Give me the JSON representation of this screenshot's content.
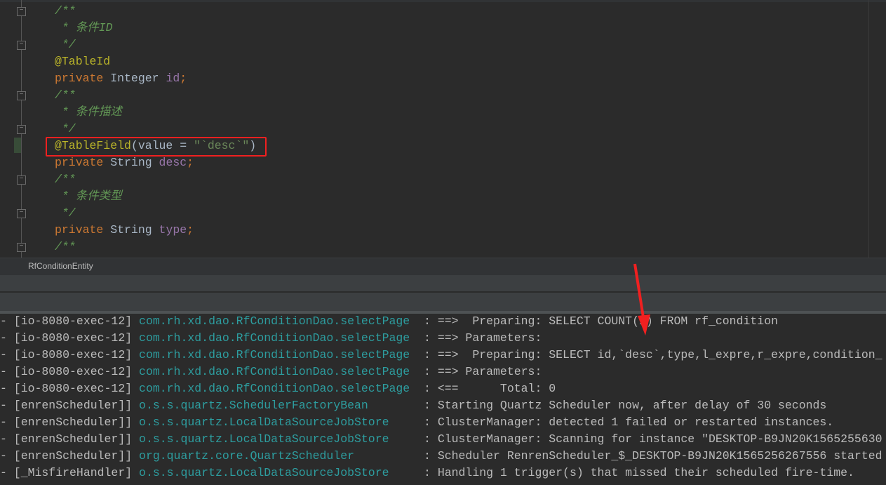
{
  "editor": {
    "lines": [
      {
        "kind": "comment",
        "text": "/**"
      },
      {
        "kind": "comment",
        "text": " * 条件ID"
      },
      {
        "kind": "comment",
        "text": " */"
      },
      {
        "kind": "annotation",
        "text": "@TableId"
      },
      {
        "kind": "field",
        "keyword": "private",
        "type": "Integer",
        "name": "id",
        "end": ";"
      },
      {
        "kind": "comment",
        "text": "/**"
      },
      {
        "kind": "comment",
        "text": " * 条件描述"
      },
      {
        "kind": "comment",
        "text": " */"
      },
      {
        "kind": "annotation-call",
        "annotation": "@TableField",
        "open": "(value = ",
        "string": "\"`desc`\"",
        "close": ")"
      },
      {
        "kind": "field",
        "keyword": "private",
        "type": "String",
        "name": "desc",
        "end": ";"
      },
      {
        "kind": "comment",
        "text": "/**"
      },
      {
        "kind": "comment",
        "text": " * 条件类型"
      },
      {
        "kind": "comment",
        "text": " */"
      },
      {
        "kind": "field",
        "keyword": "private",
        "type": "String",
        "name": "type",
        "end": ";"
      },
      {
        "kind": "comment",
        "text": "/**"
      }
    ],
    "breadcrumb": "RfConditionEntity"
  },
  "console": {
    "lines": [
      {
        "thread": "- [io-8080-exec-12] ",
        "logger": "com.rh.xd.dao.RfConditionDao.selectPage  ",
        "message": ": ==>  Preparing: SELECT COUNT(1) FROM rf_condition"
      },
      {
        "thread": "- [io-8080-exec-12] ",
        "logger": "com.rh.xd.dao.RfConditionDao.selectPage  ",
        "message": ": ==> Parameters: "
      },
      {
        "thread": "- [io-8080-exec-12] ",
        "logger": "com.rh.xd.dao.RfConditionDao.selectPage  ",
        "message": ": ==>  Preparing: SELECT id,`desc`,type,l_expre,r_expre,condition_"
      },
      {
        "thread": "- [io-8080-exec-12] ",
        "logger": "com.rh.xd.dao.RfConditionDao.selectPage  ",
        "message": ": ==> Parameters: "
      },
      {
        "thread": "- [io-8080-exec-12] ",
        "logger": "com.rh.xd.dao.RfConditionDao.selectPage  ",
        "message": ": <==      Total: 0"
      },
      {
        "thread": "- [enrenScheduler]] ",
        "logger": "o.s.s.quartz.SchedulerFactoryBean        ",
        "message": ": Starting Quartz Scheduler now, after delay of 30 seconds"
      },
      {
        "thread": "- [enrenScheduler]] ",
        "logger": "o.s.s.quartz.LocalDataSourceJobStore     ",
        "message": ": ClusterManager: detected 1 failed or restarted instances."
      },
      {
        "thread": "- [enrenScheduler]] ",
        "logger": "o.s.s.quartz.LocalDataSourceJobStore     ",
        "message": ": ClusterManager: Scanning for instance \"DESKTOP-B9JN20K1565255630"
      },
      {
        "thread": "- [enrenScheduler]] ",
        "logger": "org.quartz.core.QuartzScheduler          ",
        "message": ": Scheduler RenrenScheduler_$_DESKTOP-B9JN20K1565256267556 started"
      },
      {
        "thread": "- [_MisfireHandler] ",
        "logger": "o.s.s.quartz.LocalDataSourceJobStore     ",
        "message": ": Handling 1 trigger(s) that missed their scheduled fire-time."
      }
    ]
  },
  "colors": {
    "highlight": "#f02020",
    "arrow": "#f02020",
    "logger": "#2d9d9f",
    "comment": "#629755",
    "keyword": "#cc7832",
    "annotation": "#bbb529"
  }
}
